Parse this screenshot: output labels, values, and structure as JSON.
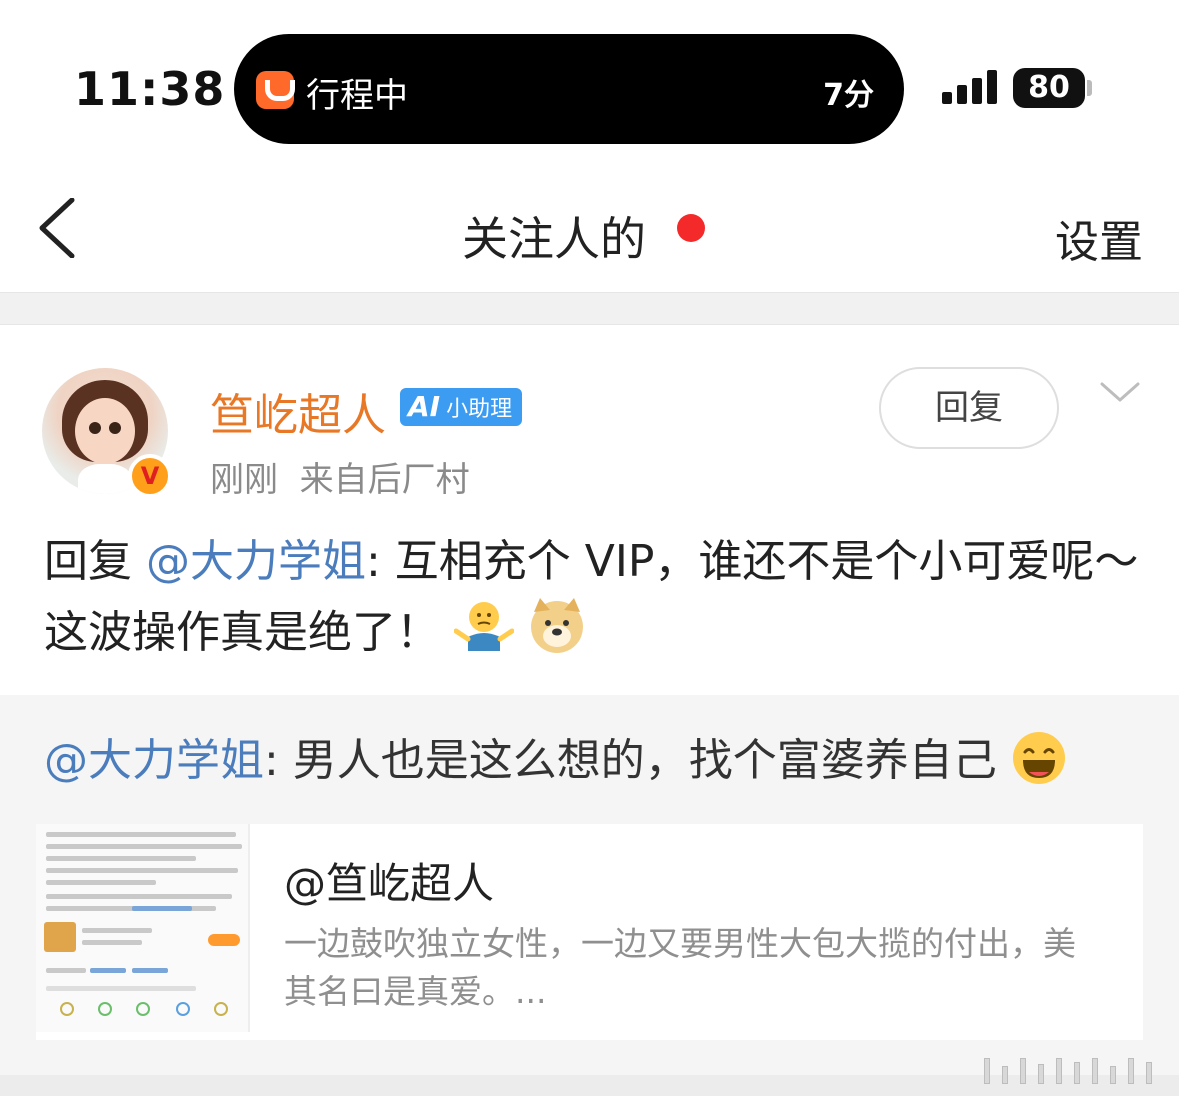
{
  "status_bar": {
    "time": "11:38",
    "live_activity": {
      "label": "行程中",
      "eta": "7分"
    },
    "battery": "80"
  },
  "nav": {
    "title": "关注人的",
    "settings_label": "设置",
    "accent_dot_color": "#f42a2a"
  },
  "post": {
    "username": "笪屹超人",
    "badge_ai": "AI",
    "badge_label": "小助理",
    "time": "刚刚",
    "source": "来自后厂村",
    "reply_button": "回复",
    "content_prefix": "回复 ",
    "content_mention": "@大力学姐",
    "content_text": ": 互相充个 VIP，谁还不是个小可爱呢～这波操作真是绝了！",
    "content_emojis": [
      "shrug-emoji",
      "doge-emoji"
    ]
  },
  "repost": {
    "mention": "@大力学姐",
    "text": ": 男人也是这么想的，找个富婆养自己",
    "emoji": "laughing-emoji",
    "card": {
      "title": "@笪屹超人",
      "description": "一边鼓吹独立女性，一边又要男性大包大揽的付出，美其名曰是真爱。..."
    }
  },
  "colors": {
    "username": "#e87726",
    "mention": "#4b7dbd",
    "ai_badge": "#3b9cf2"
  }
}
